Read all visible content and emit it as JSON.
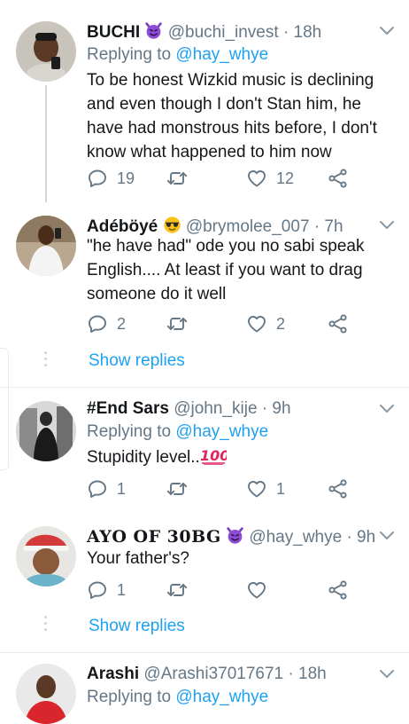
{
  "tweets": [
    {
      "name": "BUCHI",
      "handle": "@buchi_invest",
      "time": "· 18h",
      "replying_prefix": "Replying to",
      "replying_to": "@hay_whye",
      "text": "To be honest Wizkid music is declining and even though I don't Stan him, he have had monstrous hits before, I don't know what happened to him now",
      "replies": "19",
      "retweets": "",
      "likes": "12"
    },
    {
      "name": "Adéböyé",
      "handle": "@brymolee_007",
      "time": "· 7h",
      "text": "\"he have had\" ode you no sabi speak English.... At least if you want to drag someone do it well",
      "replies": "2",
      "retweets": "",
      "likes": "2",
      "show_replies": "Show replies"
    },
    {
      "name": "#End Sars",
      "handle": "@john_kije",
      "time": "· 9h",
      "replying_prefix": "Replying to",
      "replying_to": "@hay_whye",
      "text": "Stupidity level..",
      "replies": "1",
      "retweets": "",
      "likes": "1"
    },
    {
      "name": "AYO OF 30BG",
      "handle": "@hay_whye",
      "time": "· 9h",
      "text": "Your father's?",
      "replies": "1",
      "retweets": "",
      "likes": "",
      "show_replies": "Show replies"
    },
    {
      "name": "Arashi",
      "handle": "@Arashi37017671",
      "time": "· 18h",
      "replying_prefix": "Replying to",
      "replying_to": "@hay_whye",
      "text": "",
      "replies": "",
      "retweets": "",
      "likes": ""
    }
  ],
  "icons": {
    "devil": "smiling-imp-emoji",
    "sunglasses": "sunglasses-emoji",
    "hundred": "hundred-points-emoji",
    "reply": "reply-icon",
    "retweet": "retweet-icon",
    "like": "heart-icon",
    "share": "share-icon",
    "more": "chevron-down-icon"
  },
  "colors": {
    "link": "#1da1f2",
    "secondary": "#657786",
    "line": "#ccd6dd",
    "devil": "#7b3fc4"
  }
}
